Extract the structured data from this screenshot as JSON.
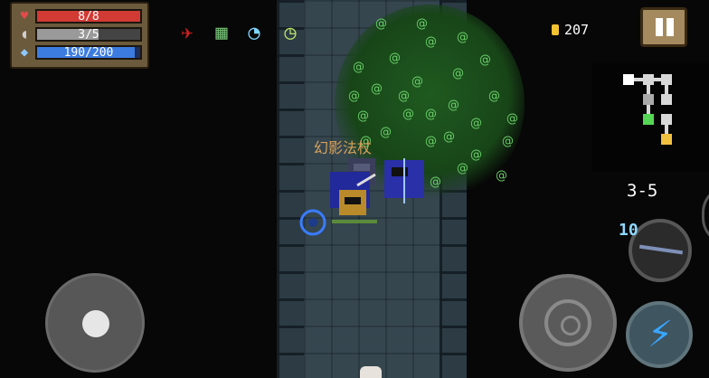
{
  "hud": {
    "hp": {
      "current": 8,
      "max": 8,
      "text": "8/8",
      "color": "#d23a34"
    },
    "armor": {
      "current": 3,
      "max": 5,
      "text": "3/5",
      "color": "#9a9a9a"
    },
    "energy": {
      "current": 190,
      "max": 200,
      "text": "190/200",
      "color": "#3c7ce0"
    }
  },
  "buffs": [
    "rocket-buff-icon",
    "maze-buff-icon",
    "speed-buff-icon",
    "clock-buff-icon"
  ],
  "coins": "207",
  "level": "3-5",
  "enemy_label": "幻影法杖",
  "weapon": {
    "name_icon": "staff-icon",
    "energy_cost": "10"
  },
  "controls": {
    "move": "joystick",
    "attack": "crosshair-icon",
    "skill": "lightning-icon",
    "pause": "pause-icon"
  },
  "colors": {
    "accent_energy": "#39a6ff",
    "coin": "#f2c230",
    "pause_bg": "#a58a5f"
  }
}
